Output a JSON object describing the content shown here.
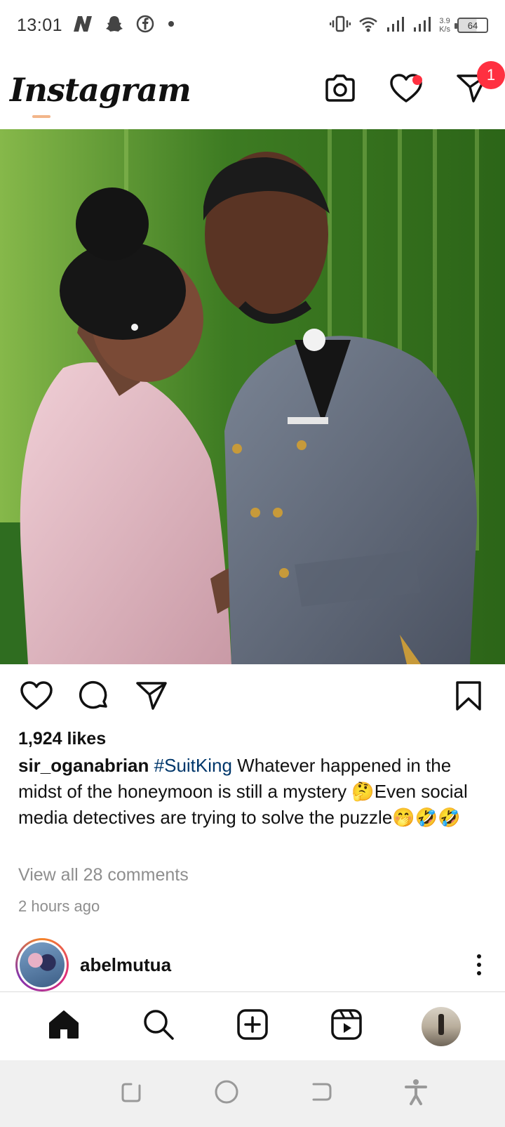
{
  "status_bar": {
    "time": "13:01",
    "net_speed_value": "3.9",
    "net_speed_unit": "K/s",
    "battery": "64",
    "left_icons": [
      "n-app-icon",
      "snapchat-icon",
      "facebook-icon",
      "dot-icon"
    ],
    "right_icons": [
      "vibrate-icon",
      "wifi-icon",
      "signal-icon",
      "signal-icon",
      "battery-icon"
    ]
  },
  "header": {
    "logo": "Instagram",
    "dm_badge": "1",
    "icons": [
      "camera-icon",
      "heart-icon",
      "direct-message-icon"
    ]
  },
  "post": {
    "likes": "1,924 likes",
    "username": "sir_oganabrian",
    "hashtag": "#SuitKing",
    "caption": " Whatever happened in the midst of the honeymoon is still a mystery 🤔Even social media detectives are trying to solve the puzzle🤭🤣🤣",
    "view_comments": "View all 28 comments",
    "time_ago": "2 hours ago",
    "photo_label": "post-photo"
  },
  "next_post": {
    "username": "abelmutua"
  },
  "bottom_nav": [
    "home-icon",
    "search-icon",
    "create-post-icon",
    "reels-icon",
    "profile-avatar"
  ],
  "colors": {
    "notification_red": "#ff3040",
    "hashtag_blue": "#00376b",
    "secondary_text": "#8e8e8e"
  }
}
